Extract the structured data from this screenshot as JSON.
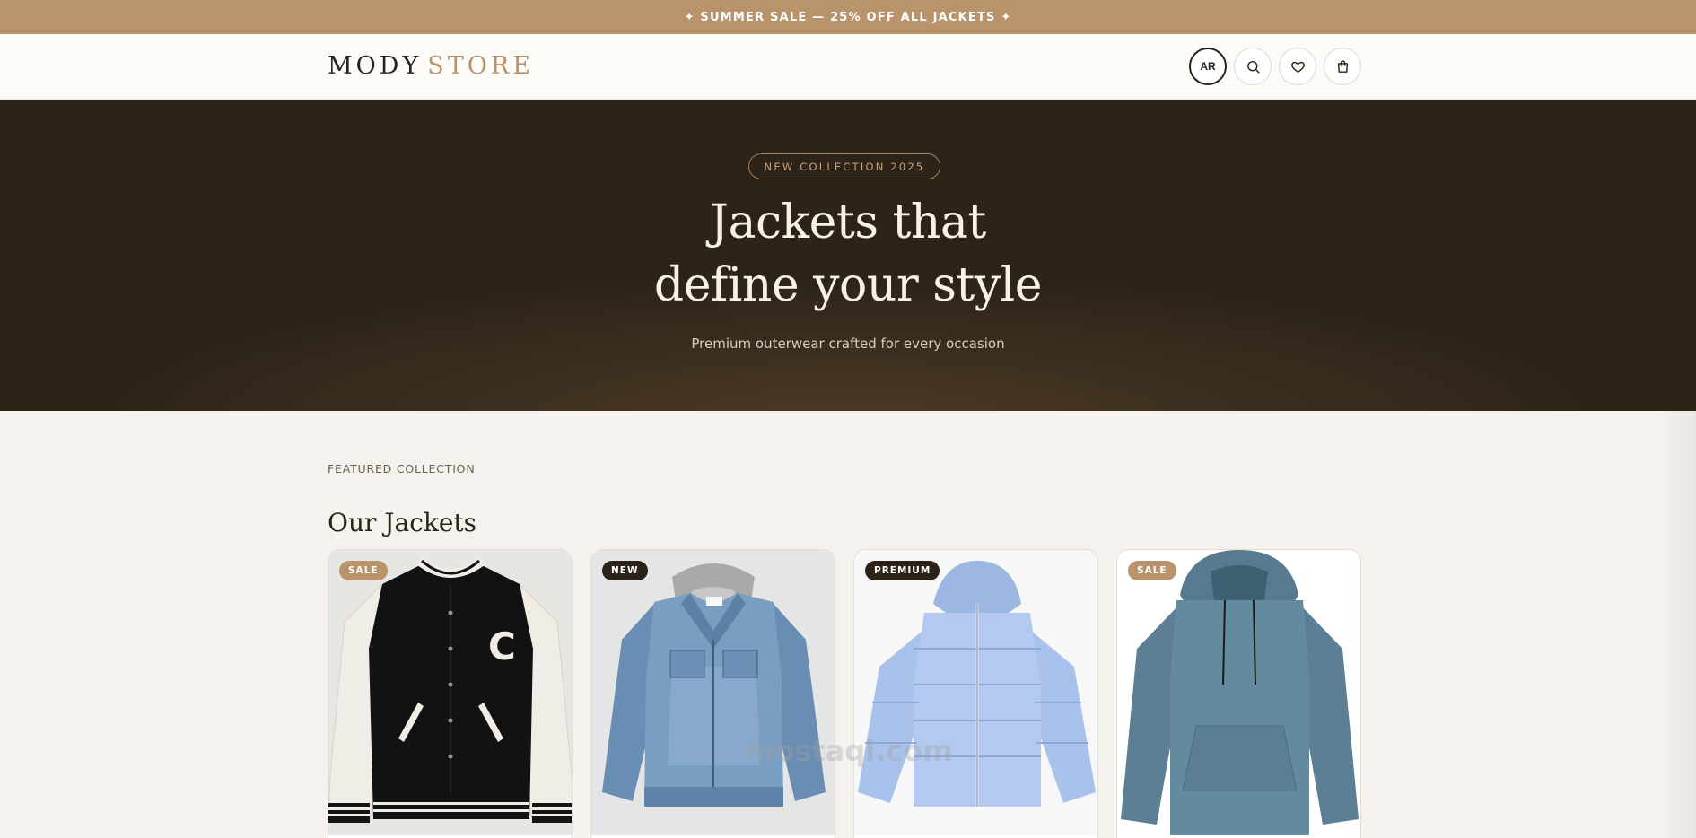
{
  "announcement": {
    "text": "✦ SUMMER SALE — 25% OFF ALL JACKETS ✦"
  },
  "header": {
    "logo_part1": "MODY",
    "logo_part2": "STORE",
    "lang_label": "AR",
    "icons": [
      "search-icon",
      "heart-icon",
      "shopping-bag-icon"
    ]
  },
  "hero": {
    "tag": "NEW COLLECTION 2025",
    "title_line1": "Jackets that",
    "title_line2": "define your style",
    "subtitle": "Premium outerwear crafted for every occasion"
  },
  "featured": {
    "eyebrow": "FEATURED COLLECTION",
    "title": "Our Jackets",
    "products": [
      {
        "badge": "SALE",
        "badge_color": "#b9946a",
        "image": "varsity-jacket"
      },
      {
        "badge": "NEW",
        "badge_color": "#2b2218",
        "image": "denim-jacket"
      },
      {
        "badge": "PREMIUM",
        "badge_color": "#2b2218",
        "image": "puffer-jacket"
      },
      {
        "badge": "SALE",
        "badge_color": "#b9946a",
        "image": "hoodie"
      }
    ]
  },
  "watermark": {
    "text": "mostaql.com"
  },
  "colors": {
    "accent": "#b9946a",
    "dark": "#2b2218",
    "hero_bg": "#2d2419"
  }
}
